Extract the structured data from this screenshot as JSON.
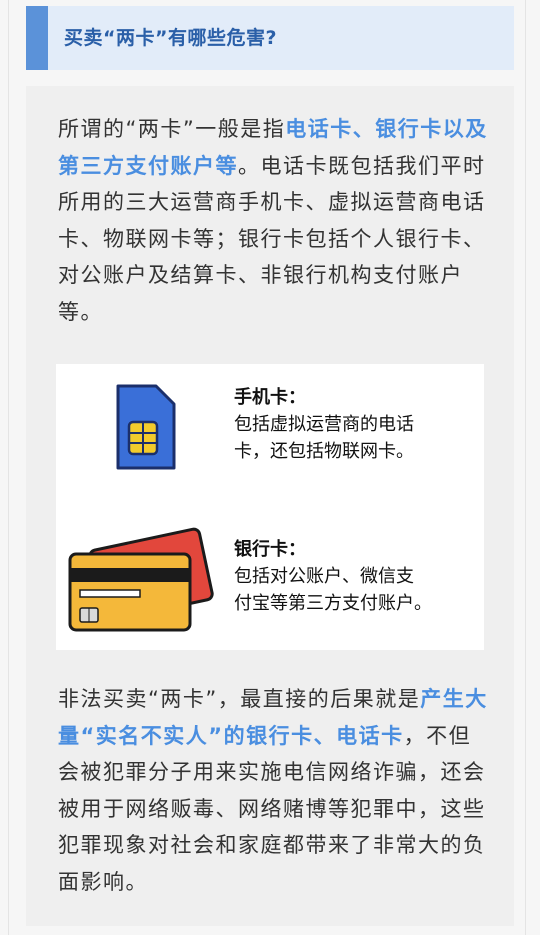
{
  "header": {
    "title": "买卖“两卡”有哪些危害?"
  },
  "paragraph1": {
    "intro": "所谓的“两卡”一般是指",
    "highlight": "电话卡、银行卡以及第三方支付账户等",
    "rest": "。电话卡既包括我们平时所用的三大运营商手机卡、虚拟运营商电话卡、物联网卡等；银行卡包括个人银行卡、对公账户及结算卡、非银行机构支付账户等。"
  },
  "figure": {
    "sim_icon": "sim-card-icon",
    "bank_icon": "bank-card-icon",
    "sim_caption": {
      "title": "手机卡：",
      "line1": "包括虚拟运营商的电话",
      "line2": "卡，还包括物联网卡。"
    },
    "bank_caption": {
      "title": "银行卡：",
      "line1": "包括对公账户、微信支",
      "line2": "付宝等第三方支付账户。"
    }
  },
  "paragraph2": {
    "intro": "非法买卖“两卡”，最直接的后果就是",
    "highlight": "产生大量“实名不实人”的银行卡、电话卡",
    "rest": "，不但会被犯罪分子用来实施电信网络诈骗，还会被用于网络贩毒、网络赌博等犯罪中，这些犯罪现象对社会和家庭都带来了非常大的负面影响。"
  },
  "colors": {
    "accent": "#5b92d9",
    "highlight": "#4a8ee0",
    "header_bg": "#e2ecf9",
    "sim_blue": "#3a6fd8",
    "chip_yellow": "#f2cb2c",
    "bank_orange": "#f4b83a",
    "bank_red": "#e2473c"
  }
}
